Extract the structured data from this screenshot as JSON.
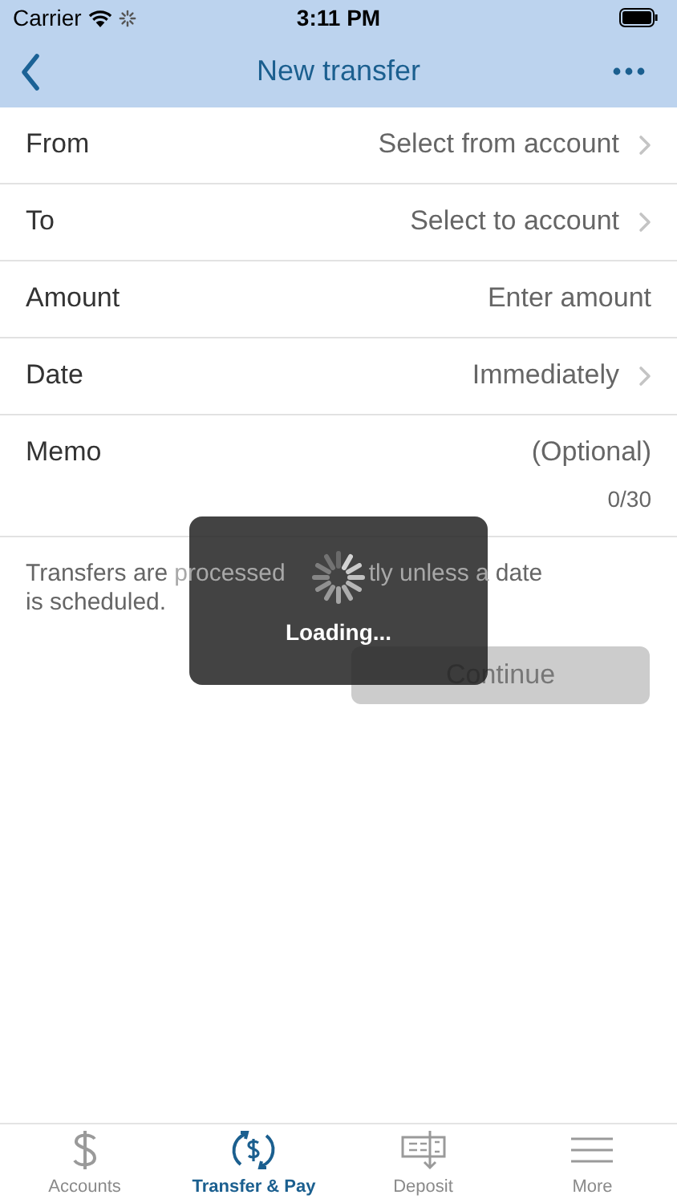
{
  "status_bar": {
    "carrier": "Carrier",
    "time": "3:11 PM"
  },
  "nav_bar": {
    "title": "New transfer"
  },
  "fields": [
    {
      "kind": "select",
      "label": "From",
      "value": "Select from account"
    },
    {
      "kind": "select",
      "label": "To",
      "value": "Select to account"
    },
    {
      "kind": "input",
      "label": "Amount",
      "placeholder": "Enter amount"
    },
    {
      "kind": "select",
      "label": "Date",
      "value": "Immediately"
    },
    {
      "kind": "memo",
      "label": "Memo",
      "placeholder": "(Optional)",
      "counter": "0/30"
    }
  ],
  "info_lines": [
    [
      {
        "text": "Transfers are",
        "covered": false
      },
      {
        "text": "processed",
        "covered": true
      },
      {
        "text": "tly unless a",
        "covered": true
      },
      {
        "text": "date",
        "covered": false
      }
    ],
    [
      {
        "text": "is scheduled.",
        "covered": false
      }
    ]
  ],
  "continue_button": {
    "label": "Continue",
    "disabled": true
  },
  "loading_overlay": {
    "label": "Loading..."
  },
  "tab_bar": [
    {
      "kind": "dollar",
      "label": "Accounts",
      "selected": false
    },
    {
      "kind": "transfer",
      "label": "Transfer & Pay",
      "selected": true
    },
    {
      "kind": "deposit",
      "label": "Deposit",
      "selected": false
    },
    {
      "kind": "more",
      "label": "More",
      "selected": false
    }
  ]
}
